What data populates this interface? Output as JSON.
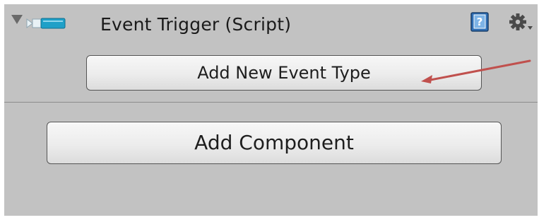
{
  "component": {
    "title": "Event Trigger (Script)",
    "icons": {
      "foldout": "foldout-triangle-icon",
      "script": "script-component-icon",
      "help": "help-book-icon",
      "settings": "gear-icon"
    }
  },
  "buttons": {
    "add_event_type": "Add New Event Type",
    "add_component": "Add Component"
  },
  "annotation": {
    "arrow_color": "#c0504d"
  },
  "colors": {
    "panel_background": "#c2c2c2",
    "button_border": "#555555",
    "divider": "#8c8c8c"
  }
}
